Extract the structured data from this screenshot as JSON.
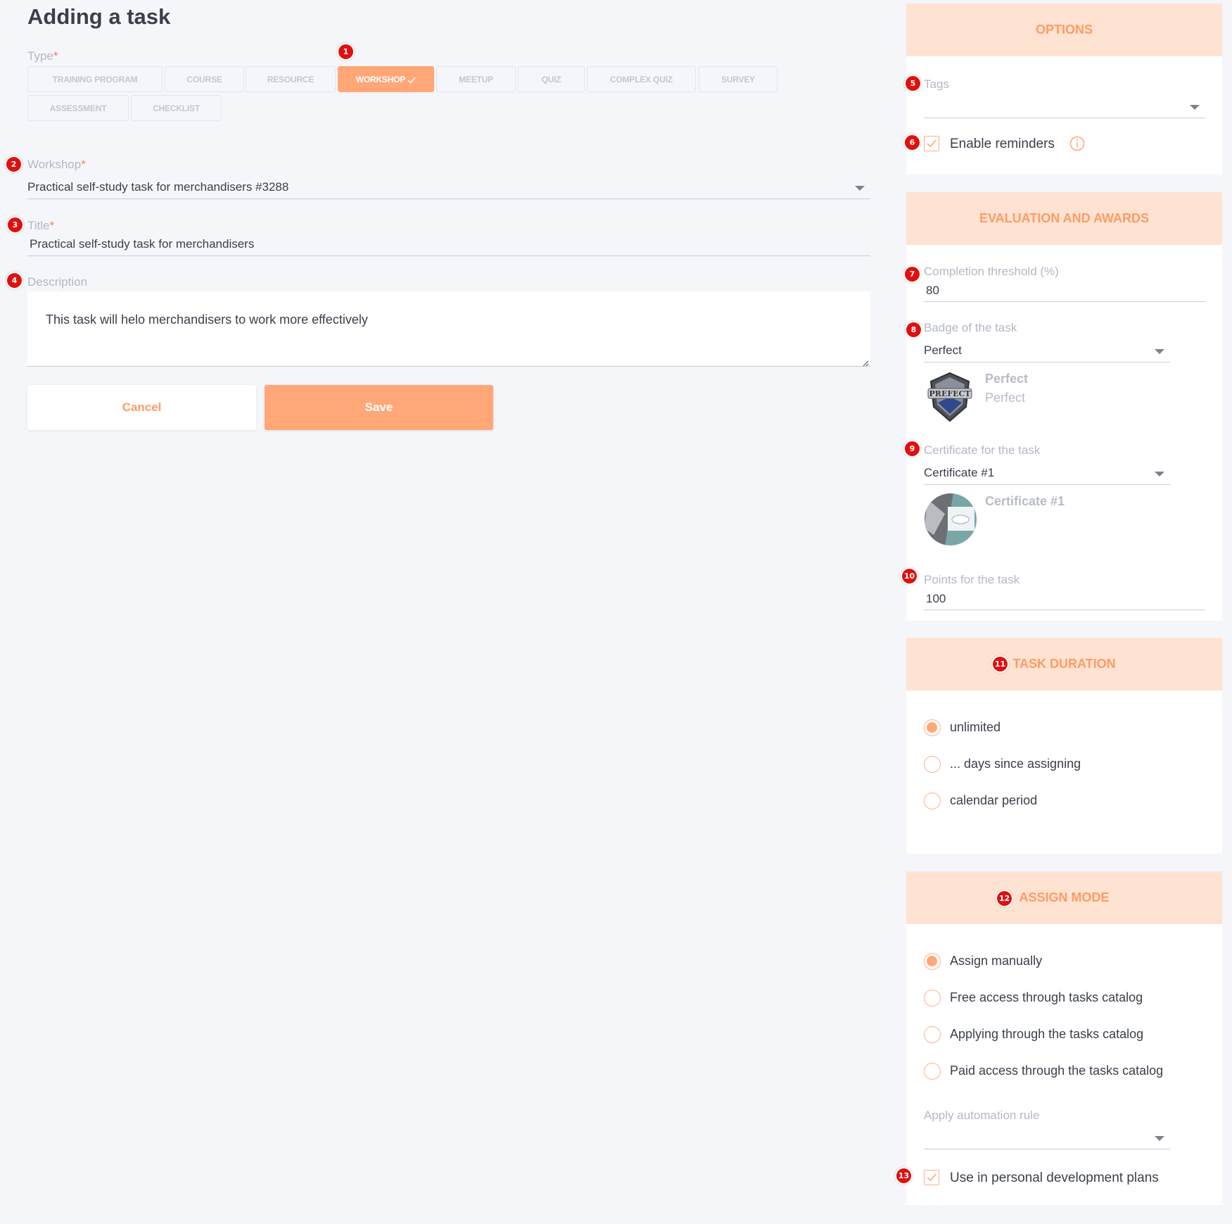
{
  "page": {
    "title": "Adding a task"
  },
  "type": {
    "label": "Type",
    "required_mark": "*",
    "options": [
      {
        "label": "TRAINING PROGRAM",
        "active": false
      },
      {
        "label": "COURSE",
        "active": false
      },
      {
        "label": "RESOURCE",
        "active": false
      },
      {
        "label": "WORKSHOP",
        "active": true
      },
      {
        "label": "MEETUP",
        "active": false
      },
      {
        "label": "QUIZ",
        "active": false
      },
      {
        "label": "COMPLEX QUIZ",
        "active": false
      },
      {
        "label": "SURVEY",
        "active": false
      },
      {
        "label": "ASSESSMENT",
        "active": false
      },
      {
        "label": "CHECKLIST",
        "active": false
      }
    ]
  },
  "workshop": {
    "label": "Workshop",
    "required_mark": "*",
    "value": "Practical self-study task for merchandisers #3288"
  },
  "title_field": {
    "label": "Title",
    "required_mark": "*",
    "value": "Practical self-study task for merchandisers"
  },
  "description": {
    "label": "Description",
    "value": "This task will helo merchandisers to work more effectively"
  },
  "actions": {
    "cancel": "Cancel",
    "save": "Save"
  },
  "options_panel": {
    "heading": "OPTIONS",
    "tags_label": "Tags",
    "tags_value": "",
    "enable_reminders": {
      "label": "Enable reminders",
      "checked": true
    }
  },
  "evaluation_panel": {
    "heading": "EVALUATION AND AWARDS",
    "completion_threshold": {
      "label": "Completion threshold (%)",
      "value": "80"
    },
    "badge": {
      "label": "Badge of the task",
      "value": "Perfect",
      "preview_title": "Perfect",
      "preview_subtitle": "Perfect",
      "image_text": "PREFECT"
    },
    "certificate": {
      "label": "Certificate for the task",
      "value": "Certificate #1",
      "preview_title": "Certificate #1"
    },
    "points": {
      "label": "Points for the task",
      "value": "100"
    }
  },
  "duration_panel": {
    "heading": "TASK DURATION",
    "options": [
      {
        "label": "unlimited",
        "selected": true
      },
      {
        "label": "... days since assigning",
        "selected": false
      },
      {
        "label": "calendar period",
        "selected": false
      }
    ]
  },
  "assign_panel": {
    "heading": "ASSIGN MODE",
    "options": [
      {
        "label": "Assign manually",
        "selected": true
      },
      {
        "label": "Free access through tasks catalog",
        "selected": false
      },
      {
        "label": "Applying through the tasks catalog",
        "selected": false
      },
      {
        "label": "Paid access through the tasks catalog",
        "selected": false
      }
    ],
    "automation_rule_label": "Apply automation rule",
    "automation_rule_value": "",
    "personal_plans": {
      "label": "Use in personal development plans",
      "checked": true
    }
  },
  "markers": [
    "1",
    "2",
    "3",
    "4",
    "5",
    "6",
    "7",
    "8",
    "9",
    "10",
    "11",
    "12",
    "13"
  ],
  "colors": {
    "accent": "#ffa777",
    "accent_light": "#ffe3d2",
    "marker": "#e0100f",
    "background": "#f4f6fa"
  }
}
